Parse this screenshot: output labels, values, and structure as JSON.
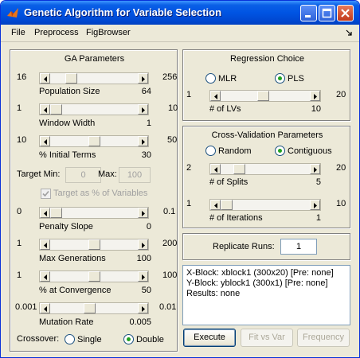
{
  "window": {
    "title": "Genetic Algorithm for Variable Selection",
    "title_color": "#0054e3"
  },
  "menu": {
    "items": [
      "File",
      "Preprocess",
      "FigBrowser"
    ]
  },
  "ga_parameters": {
    "title": "GA Parameters",
    "population_size": {
      "min": "16",
      "max": "256",
      "label": "Population Size",
      "value": "64",
      "fraction": 0.2
    },
    "window_width": {
      "min": "1",
      "max": "10",
      "label": "Window Width",
      "value": "1",
      "fraction": 0.0
    },
    "initial_terms": {
      "min": "10",
      "max": "50",
      "label": "% Initial Terms",
      "value": "30",
      "fraction": 0.5
    },
    "target_min_label": "Target Min:",
    "target_min_value": "0",
    "target_max_label": "Max:",
    "target_max_value": "100",
    "target_pct_label": "Target as % of Variables",
    "penalty_slope": {
      "min": "0",
      "max": "0.1",
      "label": "Penalty Slope",
      "value": "0",
      "fraction": 0.0
    },
    "max_generations": {
      "min": "1",
      "max": "200",
      "label": "Max Generations",
      "value": "100",
      "fraction": 0.5
    },
    "convergence": {
      "min": "1",
      "max": "100",
      "label": "% at Convergence",
      "value": "50",
      "fraction": 0.5
    },
    "mutation_rate": {
      "min": "0.001",
      "max": "0.01",
      "label": "Mutation Rate",
      "value": "0.005",
      "fraction": 0.44
    },
    "crossover_label": "Crossover:",
    "crossover_single": "Single",
    "crossover_double": "Double",
    "crossover_selected": "Double"
  },
  "regression_choice": {
    "title": "Regression Choice",
    "mlr_label": "MLR",
    "pls_label": "PLS",
    "selected": "PLS",
    "lvs": {
      "min": "1",
      "max": "20",
      "label": "# of LVs",
      "value": "10",
      "fraction": 0.47
    }
  },
  "cross_validation": {
    "title": "Cross-Validation Parameters",
    "random_label": "Random",
    "contiguous_label": "Contiguous",
    "selected": "Contiguous",
    "splits": {
      "min": "2",
      "max": "20",
      "label": "# of Splits",
      "value": "5",
      "fraction": 0.17
    },
    "iterations": {
      "min": "1",
      "max": "10",
      "label": "# of Iterations",
      "value": "1",
      "fraction": 0.0
    }
  },
  "replicate": {
    "label": "Replicate Runs:",
    "value": "1"
  },
  "info": {
    "lines": [
      "X-Block: xblock1 (300x20) [Pre: none]",
      "Y-Block: yblock1 (300x1) [Pre: none]",
      "Results: none"
    ]
  },
  "buttons": {
    "execute": "Execute",
    "fit_vs_var": "Fit vs Var",
    "frequency": "Frequency"
  }
}
